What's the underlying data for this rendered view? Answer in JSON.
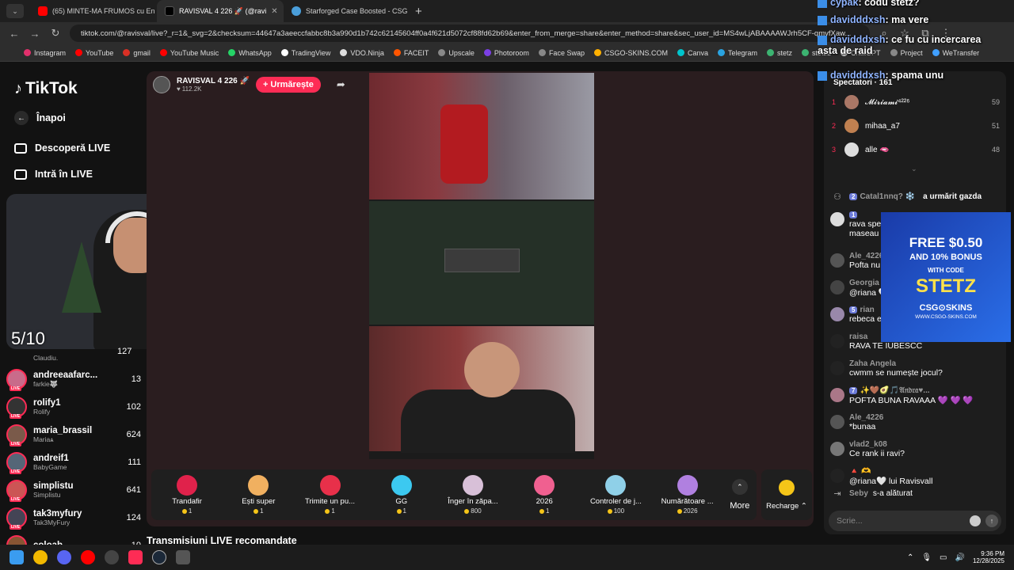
{
  "browser": {
    "tabs": [
      {
        "title": "(65) MINTE-MA FRUMOS cu En",
        "color": "#ff0000"
      },
      {
        "title": "RAVISVAL 4 226 🚀 (@ravi",
        "color": "#000000"
      },
      {
        "title": "Starforged Case Boosted - CSG",
        "color": "#4a9eda"
      }
    ],
    "url": "tiktok.com/@ravisval/live?_r=1&_svg=2&checksum=44647a3aeeccfabbc8b3a990d1b742c62145604ff0a4f621d5072cf88fd62b69&enter_from_merge=share&enter_method=share&sec_user_id=MS4wLjABAAAAWJrh5CF-qmvfXaw...",
    "bookmarks": [
      {
        "label": "Instagram",
        "color": "#e1306c"
      },
      {
        "label": "YouTube",
        "color": "#ff0000"
      },
      {
        "label": "gmail",
        "color": "#d93025"
      },
      {
        "label": "YouTube Music",
        "color": "#ff0000"
      },
      {
        "label": "WhatsApp",
        "color": "#25d366"
      },
      {
        "label": "TradingView",
        "color": "#ffffff"
      },
      {
        "label": "VDO.Ninja",
        "color": "#dddddd"
      },
      {
        "label": "FACEIT",
        "color": "#ff5500"
      },
      {
        "label": "Upscale",
        "color": "#888888"
      },
      {
        "label": "Photoroom",
        "color": "#7b3fe4"
      },
      {
        "label": "Face Swap",
        "color": "#888888"
      },
      {
        "label": "CSGO-SKINS.COM",
        "color": "#ffb000"
      },
      {
        "label": "Canva",
        "color": "#00c4cc"
      },
      {
        "label": "Telegram",
        "color": "#2aa3e0"
      },
      {
        "label": "stetz",
        "color": "#3cb371"
      },
      {
        "label": "stetz2",
        "color": "#3cb371"
      },
      {
        "label": "ChatGPT",
        "color": "#dddddd"
      },
      {
        "label": "Project",
        "color": "#888888"
      },
      {
        "label": "WeTransfer",
        "color": "#409fff"
      }
    ]
  },
  "sidebar": {
    "logo": "TikTok",
    "back": "Înapoi",
    "discover": "Descoperă LIVE",
    "enter": "Intră în LIVE",
    "partial_count": "127",
    "partial_sub": "Claudiu.",
    "following": [
      {
        "name": "andreeaafarc...",
        "sub": "farkie🐺",
        "count": "13",
        "color": "#c96b8a"
      },
      {
        "name": "rolify1",
        "sub": "Rolify",
        "count": "102",
        "color": "#333333"
      },
      {
        "name": "maria_brassil",
        "sub": "Mariaѧ",
        "count": "624",
        "color": "#7a5a4a"
      },
      {
        "name": "andreif1",
        "sub": "BabyGame",
        "count": "111",
        "color": "#556677"
      },
      {
        "name": "simplistu",
        "sub": "Simplistu",
        "count": "641",
        "color": "#cc5555"
      },
      {
        "name": "tak3myfury",
        "sub": "Tak3MyFury",
        "count": "124",
        "color": "#444455"
      },
      {
        "name": "coloab",
        "sub": "",
        "count": "10",
        "color": "#885533"
      }
    ]
  },
  "stream": {
    "host_name": "RAVISVAL 4 226 🚀",
    "host_likes": "112.2K",
    "follow_label": "+ Urmărește",
    "overlay_score": "5/10",
    "section_below": "Transmisiuni LIVE recomandate"
  },
  "gifts": [
    {
      "name": "Trandafir",
      "price": "1",
      "color": "#e0224b"
    },
    {
      "name": "Ești super",
      "price": "1",
      "color": "#f0b060"
    },
    {
      "name": "Trimite un pu...",
      "price": "1",
      "color": "#e8304a"
    },
    {
      "name": "GG",
      "price": "1",
      "color": "#3cc9f0"
    },
    {
      "name": "Înger în zăpa...",
      "price": "800",
      "color": "#d8c0d8"
    },
    {
      "name": "2026",
      "price": "1",
      "color": "#f06090"
    },
    {
      "name": "Controler de j...",
      "price": "100",
      "color": "#8fd0e8"
    },
    {
      "name": "Numărătoare ...",
      "price": "2026",
      "color": "#b080e0"
    }
  ],
  "gift_more": "More",
  "recharge": "Recharge",
  "viewers": {
    "label": "Spectatori · 161",
    "top": [
      {
        "rank": "1",
        "name": "𝓜𝓲𝓻𝓲𝓪𝓶𝓲⁴²²⁶",
        "score": "59",
        "color": "#aa7766"
      },
      {
        "rank": "2",
        "name": "mihaa_a7",
        "score": "51",
        "color": "#c08050"
      },
      {
        "rank": "3",
        "name": "alle 🫦",
        "score": "48",
        "color": "#dddddd"
      }
    ]
  },
  "chat": {
    "system_follow": {
      "level": "2",
      "user": "Catal1nnq? ❄️",
      "text": "a urmărit gazda"
    },
    "messages": [
      {
        "user": "",
        "text": "rava spe",
        "line2": "maseau",
        "color": "#dddddd",
        "badge": "1"
      },
      {
        "user": "Ale_4226",
        "text": "Pofta nu",
        "color": "#555555"
      },
      {
        "user": "Georgia",
        "text": "@riana 🤍",
        "color": "#444444"
      },
      {
        "user": "rian",
        "text": "rebeca e",
        "color": "#9988aa",
        "badge": "5"
      },
      {
        "user": "raisa",
        "text": "RAVA TE IUBESCC",
        "color": "#222222"
      },
      {
        "user": "Zaha Angela",
        "text": "cwmm se numește jocul?",
        "color": "#222222"
      },
      {
        "user": "✨🤎🥑🎵𝔄𝔫𝔡𝔯𝔞♥...",
        "text": "POFTA BUNA RAVAAA 💜 💜 💜",
        "color": "#aa7788",
        "badge": "7"
      },
      {
        "user": "Ale_4226",
        "text": "*bunaa",
        "color": "#555555"
      },
      {
        "user": "vlad2_k08",
        "text": "Ce rank ii ravi?",
        "color": "#777777"
      },
      {
        "user": "🔺 🫶",
        "text": "@riana🤍 lui Ravisvall",
        "color": "#222222"
      }
    ],
    "join": {
      "user": "Seby",
      "text": "s-a alăturat"
    },
    "input_placeholder": "Scrie..."
  },
  "overlay_chat": [
    {
      "user": "cypak",
      "text": ": codu stetz?"
    },
    {
      "user": "davidddxsh",
      "text": ": ma vere"
    },
    {
      "user": "davidddxsh",
      "text": ": ce fu cu incercarea asta de raid"
    },
    {
      "user": "davidddxsh",
      "text": ": spama unu"
    }
  ],
  "ad": {
    "line1": "FREE $0.50",
    "line2": "AND 10% BONUS",
    "line3": "WITH CODE",
    "code": "STETZ",
    "brand": "CSG⊙SKINS",
    "site": "WWW.CSGO-SKINS.COM"
  },
  "taskbar": {
    "time": "9:36 PM",
    "date": "12/28/2025"
  }
}
